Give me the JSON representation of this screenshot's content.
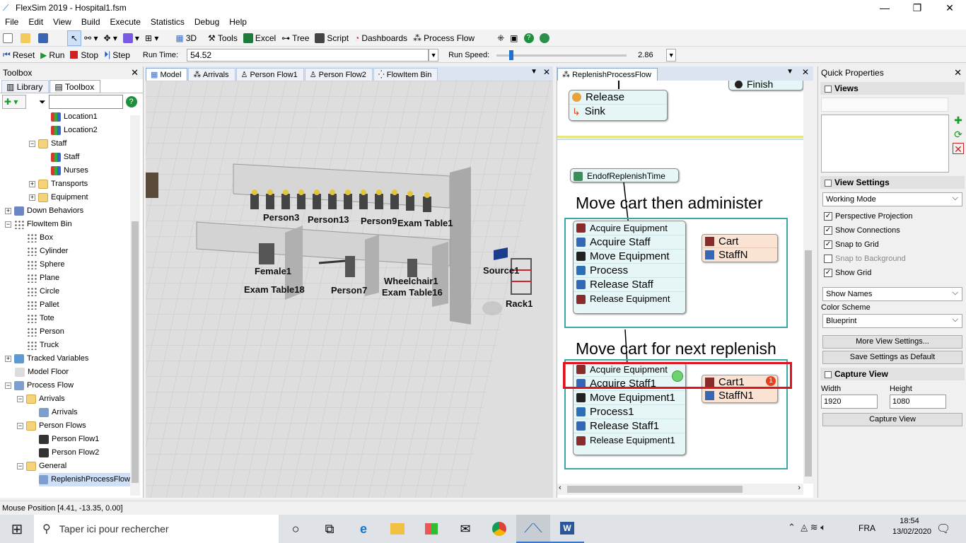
{
  "window": {
    "title": "FlexSim 2019 - Hospital1.fsm",
    "minimize": "—",
    "maximize": "❐",
    "close": "✕"
  },
  "menu": [
    "File",
    "Edit",
    "View",
    "Build",
    "Execute",
    "Statistics",
    "Debug",
    "Help"
  ],
  "toolbar": {
    "view3d": "3D",
    "tools": "Tools",
    "excel": "Excel",
    "tree": "Tree",
    "script": "Script",
    "dashboards": "Dashboards",
    "process_flow": "Process Flow"
  },
  "run": {
    "reset": "Reset",
    "run": "Run",
    "stop": "Stop",
    "step": "Step",
    "run_time_label": "Run Time:",
    "run_time": "54.52",
    "run_speed_label": "Run Speed:",
    "run_speed": "2.86"
  },
  "toolbox": {
    "title": "Toolbox",
    "tabs": [
      "Library",
      "Toolbox"
    ],
    "tree": [
      {
        "label": "Location1",
        "indent": 4,
        "icon": "people",
        "exp": ""
      },
      {
        "label": "Location2",
        "indent": 4,
        "icon": "people",
        "exp": ""
      },
      {
        "label": "Staff",
        "indent": 3,
        "icon": "folder",
        "exp": "−"
      },
      {
        "label": "Staff",
        "indent": 4,
        "icon": "people",
        "exp": ""
      },
      {
        "label": "Nurses",
        "indent": 4,
        "icon": "people",
        "exp": ""
      },
      {
        "label": "Transports",
        "indent": 3,
        "icon": "folder",
        "exp": "+"
      },
      {
        "label": "Equipment",
        "indent": 3,
        "icon": "folder",
        "exp": "+"
      },
      {
        "label": "Down Behaviors",
        "indent": 1,
        "icon": "gear",
        "exp": "+"
      },
      {
        "label": "FlowItem Bin",
        "indent": 1,
        "icon": "dots",
        "exp": "−"
      },
      {
        "label": "Box",
        "indent": 2,
        "icon": "dots",
        "exp": ""
      },
      {
        "label": "Cylinder",
        "indent": 2,
        "icon": "dots",
        "exp": ""
      },
      {
        "label": "Sphere",
        "indent": 2,
        "icon": "dots",
        "exp": ""
      },
      {
        "label": "Plane",
        "indent": 2,
        "icon": "dots",
        "exp": ""
      },
      {
        "label": "Circle",
        "indent": 2,
        "icon": "dots",
        "exp": ""
      },
      {
        "label": "Pallet",
        "indent": 2,
        "icon": "dots",
        "exp": ""
      },
      {
        "label": "Tote",
        "indent": 2,
        "icon": "dots",
        "exp": ""
      },
      {
        "label": "Person",
        "indent": 2,
        "icon": "dots",
        "exp": ""
      },
      {
        "label": "Truck",
        "indent": 2,
        "icon": "dots",
        "exp": ""
      },
      {
        "label": "Tracked Variables",
        "indent": 1,
        "icon": "chart",
        "exp": "+"
      },
      {
        "label": "Model Floor",
        "indent": 1,
        "icon": "floor",
        "exp": ""
      },
      {
        "label": "Process Flow",
        "indent": 1,
        "icon": "pf",
        "exp": "−"
      },
      {
        "label": "Arrivals",
        "indent": 2,
        "icon": "folder",
        "exp": "−"
      },
      {
        "label": "Arrivals",
        "indent": 3,
        "icon": "pf",
        "exp": ""
      },
      {
        "label": "Person Flows",
        "indent": 2,
        "icon": "folder",
        "exp": "−"
      },
      {
        "label": "Person Flow1",
        "indent": 3,
        "icon": "person",
        "exp": ""
      },
      {
        "label": "Person Flow2",
        "indent": 3,
        "icon": "person",
        "exp": ""
      },
      {
        "label": "General",
        "indent": 2,
        "icon": "folder",
        "exp": "−"
      },
      {
        "label": "ReplenishProcessFlow",
        "indent": 3,
        "icon": "pf",
        "exp": "",
        "selected": true
      }
    ]
  },
  "view_tabs": [
    "Model",
    "Arrivals",
    "Person Flow1",
    "Person Flow2",
    "FlowItem Bin"
  ],
  "model_labels": [
    {
      "text": "Person3"
    },
    {
      "text": "Person13"
    },
    {
      "text": "Person9"
    },
    {
      "text": "Exam Table1"
    },
    {
      "text": "Female1"
    },
    {
      "text": "Exam Table18"
    },
    {
      "text": "Person7"
    },
    {
      "text": "Wheelchair1"
    },
    {
      "text": "Exam Table16"
    },
    {
      "text": "Source1"
    },
    {
      "text": "Rack1"
    }
  ],
  "pf": {
    "tab": "ReplenishProcessFlow",
    "top_block": [
      "Release",
      "Sink"
    ],
    "finish": "Finish",
    "event": "EndofReplenishTime",
    "group1": {
      "title": "Move cart then administer",
      "activities": [
        "Acquire Equipment",
        "Acquire Staff",
        "Move Equipment",
        "Process",
        "Release Staff",
        "Release Equipment"
      ],
      "resources": [
        "Cart",
        "StaffN"
      ]
    },
    "group2": {
      "title": "Move cart for next replenish",
      "activities": [
        "Acquire Equipment",
        "Acquire Staff1",
        "Move Equipment1",
        "Process1",
        "Release Staff1",
        "Release Equipment1"
      ],
      "resources": [
        "Cart1",
        "StaffN1"
      ],
      "badge": "1"
    },
    "colors": {
      "group_border": "#3aa9a5",
      "highlight": "#e0141e",
      "token": "#6fd16f",
      "badge": "#e8401c"
    }
  },
  "quick": {
    "title": "Quick Properties",
    "views": "Views",
    "view_settings": "View Settings",
    "working_mode": "Working Mode",
    "checks": [
      {
        "label": "Perspective Projection",
        "checked": true
      },
      {
        "label": "Show Connections",
        "checked": true
      },
      {
        "label": "Snap to Grid",
        "checked": true
      },
      {
        "label": "Snap to Background",
        "checked": false
      },
      {
        "label": "Show Grid",
        "checked": true
      }
    ],
    "show_names": "Show Names",
    "color_scheme_label": "Color Scheme",
    "color_scheme": "Blueprint",
    "more_view": "More View Settings...",
    "save_default": "Save Settings as Default",
    "capture_view": "Capture View",
    "width_label": "Width",
    "height_label": "Height",
    "width": "1920",
    "height": "1080",
    "capture_btn": "Capture View"
  },
  "status": "Mouse Position [4.41, -13.35, 0.00]",
  "taskbar": {
    "search": "Taper ici pour rechercher",
    "lang": "FRA",
    "time": "18:54",
    "date": "13/02/2020"
  }
}
